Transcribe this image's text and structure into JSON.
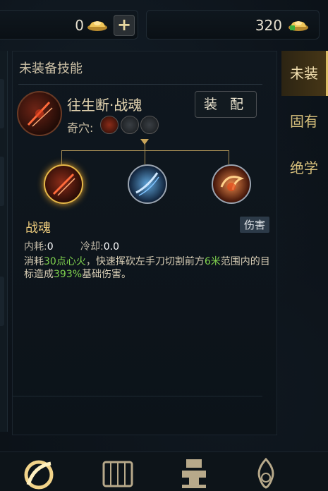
{
  "currency": {
    "gold": "0",
    "bound_gold": "320"
  },
  "panel": {
    "title": "未装备技能",
    "skill_name": "往生断·战魂",
    "acupoint_label": "奇穴:",
    "equip_button": "装 配"
  },
  "detail": {
    "sub_name": "战魂",
    "tag": "伤害",
    "stats": [
      {
        "label": "内耗:",
        "value": "0"
      },
      {
        "label": "冷却:",
        "value": "0.0"
      }
    ],
    "description": {
      "p1": "消耗",
      "h1": "30点心火",
      "p2": "，快速挥砍左手刀切割前方",
      "h2": "6米",
      "p3": "范围内的目标造成",
      "h3": "393%",
      "p4": "基础伤害。"
    }
  },
  "tabs": [
    {
      "label": "未装",
      "active": true
    },
    {
      "label": "固有",
      "active": false
    },
    {
      "label": "绝学",
      "active": false
    }
  ],
  "colors": {
    "accent_gold": "#e0bf6a",
    "highlight_green": "#7fd14e",
    "background": "#0b1117"
  },
  "icons": {
    "ingot": "gold-ingot-icon",
    "plus": "plus-icon",
    "nav": [
      "skill-swirl-icon",
      "scroll-icon",
      "anvil-icon",
      "flame-emblem-icon"
    ]
  }
}
